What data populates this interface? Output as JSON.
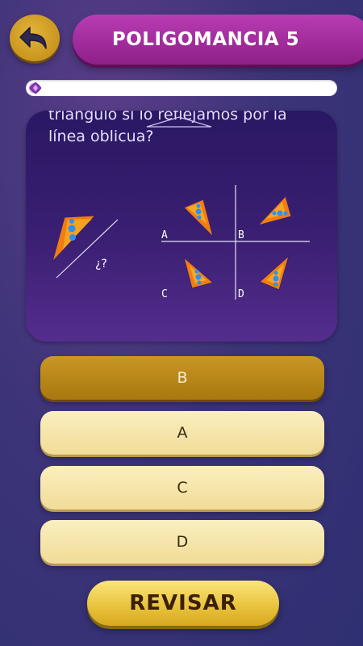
{
  "header": {
    "back_icon": "undo-arrow-icon",
    "title": "POLIGOMANCIA 5"
  },
  "progress": {
    "fraction": 0.03,
    "gem_icon": "purple-gem-icon"
  },
  "question": {
    "text": "triángulo si lo reflejamos por la\nlínea oblicua?",
    "prompt_mark": "¿?",
    "option_labels": [
      "A",
      "B",
      "C",
      "D"
    ]
  },
  "answers": [
    {
      "label": "B",
      "selected": true
    },
    {
      "label": "A",
      "selected": false
    },
    {
      "label": "C",
      "selected": false
    },
    {
      "label": "D",
      "selected": false
    }
  ],
  "check_button": {
    "label": "REVISAR"
  },
  "colors": {
    "title_bar": "#a02a9a",
    "selected_answer": "#b88616",
    "answer": "#f6e5ac",
    "triangle_orange": "#f07d12",
    "triangle_yellow": "#f7c12b",
    "dot_blue": "#2f8ff5"
  }
}
